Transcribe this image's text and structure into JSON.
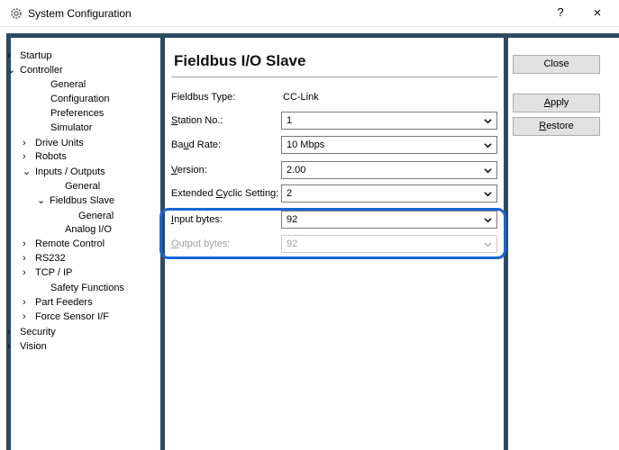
{
  "window": {
    "title": "System Configuration",
    "help": "?",
    "close": "×"
  },
  "tree": {
    "items": [
      {
        "label": "Startup",
        "chevron": "›"
      },
      {
        "label": "Controller",
        "chevron": "⌄"
      },
      {
        "label": "General"
      },
      {
        "label": "Configuration"
      },
      {
        "label": "Preferences"
      },
      {
        "label": "Simulator"
      },
      {
        "label": "Drive Units",
        "chevron": "›"
      },
      {
        "label": "Robots",
        "chevron": "›"
      },
      {
        "label": "Inputs / Outputs",
        "chevron": "⌄"
      },
      {
        "label": "General"
      },
      {
        "label": "Fieldbus Slave",
        "chevron": "⌄"
      },
      {
        "label": "General"
      },
      {
        "label": "Analog I/O"
      },
      {
        "label": "Remote Control",
        "chevron": "›"
      },
      {
        "label": "RS232",
        "chevron": "›"
      },
      {
        "label": "TCP / IP",
        "chevron": "›"
      },
      {
        "label": "Safety Functions"
      },
      {
        "label": "Part Feeders",
        "chevron": "›"
      },
      {
        "label": "Force Sensor I/F",
        "chevron": "›"
      },
      {
        "label": "Security",
        "chevron": "›"
      },
      {
        "label": "Vision",
        "chevron": "›"
      }
    ]
  },
  "page": {
    "title": "Fieldbus I/O Slave",
    "fieldbus_type": {
      "label": "Fieldbus Type:",
      "value": "CC-Link"
    },
    "station_no": {
      "label_pre": "",
      "label_ul": "S",
      "label_post": "tation No.:",
      "value": "1"
    },
    "baud_rate": {
      "label_pre": "Ba",
      "label_ul": "u",
      "label_post": "d Rate:",
      "value": "10 Mbps"
    },
    "version": {
      "label_pre": "",
      "label_ul": "V",
      "label_post": "ersion:",
      "value": "2.00"
    },
    "extended_cyclic": {
      "label_pre": "Extended ",
      "label_ul": "C",
      "label_post": "yclic Setting:",
      "value": "2"
    },
    "input_bytes": {
      "label_pre": "",
      "label_ul": "I",
      "label_post": "nput bytes:",
      "value": "92"
    },
    "output_bytes": {
      "label_pre": "",
      "label_ul": "O",
      "label_post": "utput bytes:",
      "value": "92"
    }
  },
  "buttons": {
    "close": "Close",
    "apply_ul": "A",
    "apply_rest": "pply",
    "restore_ul": "R",
    "restore_rest": "estore"
  },
  "colors": {
    "frame": "#2e4a63",
    "highlight": "#1764d4"
  }
}
